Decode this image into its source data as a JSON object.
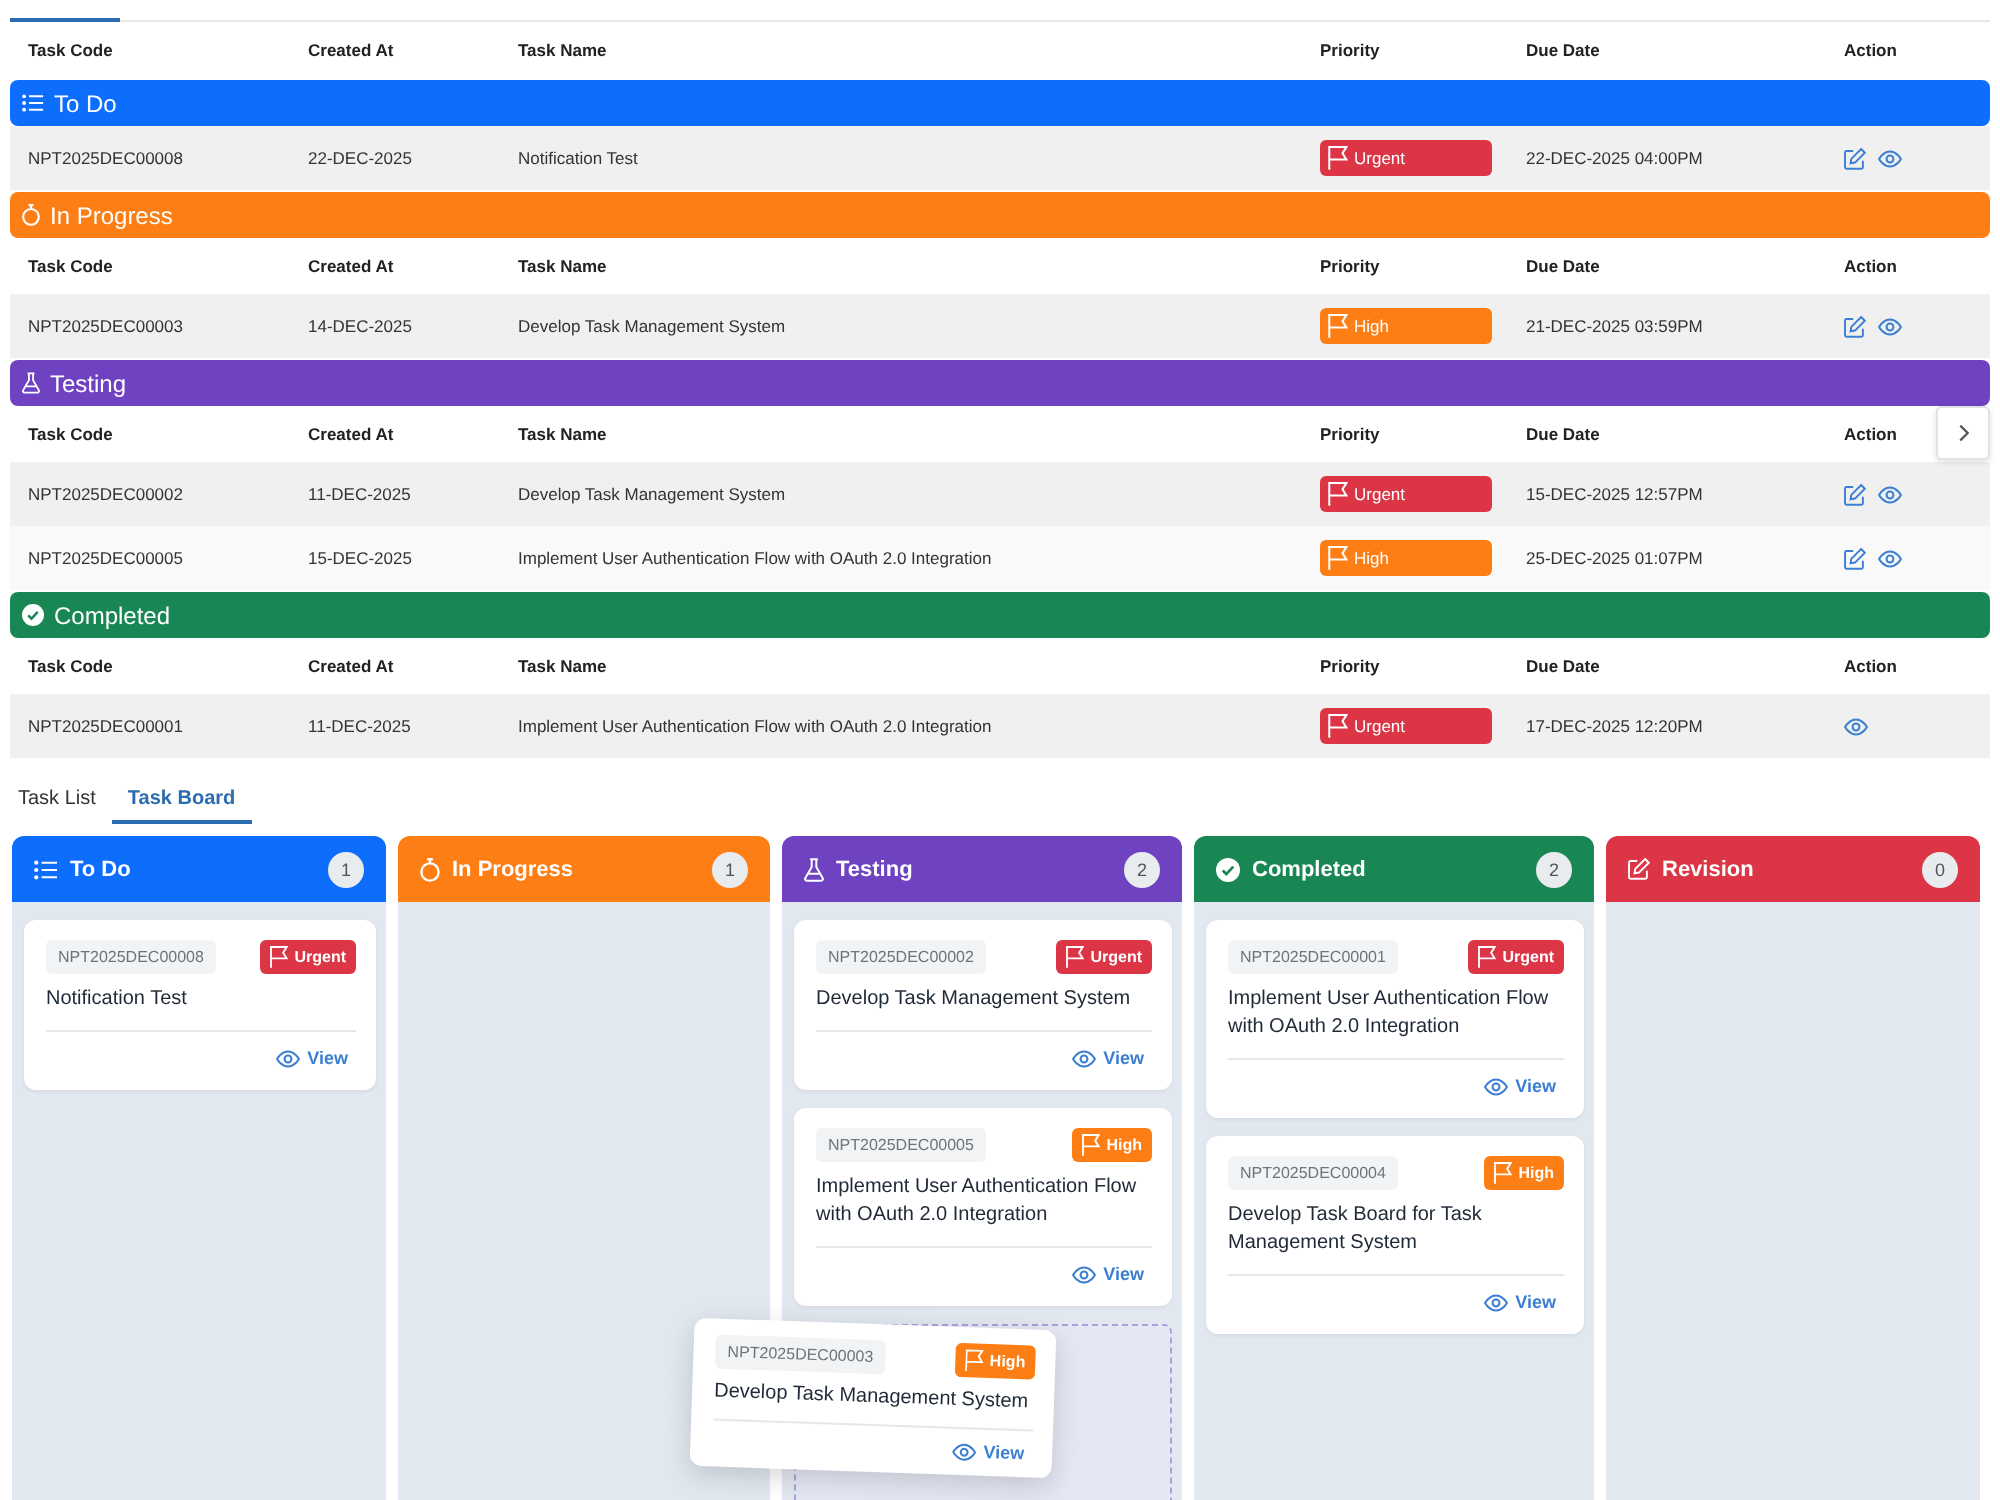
{
  "task_list": {
    "columns": [
      "Task Code",
      "Created At",
      "Task Name",
      "Priority",
      "Due Date",
      "Action"
    ],
    "groups": [
      {
        "kind": "todo",
        "title": "To Do",
        "color": "#0d6efd",
        "rows": [
          {
            "code": "NPT2025DEC00008",
            "created": "22-DEC-2025",
            "name": "Notification Test",
            "priority": {
              "label": "Urgent",
              "color": "#dc3545"
            },
            "due": "22-DEC-2025 04:00PM",
            "editable": true
          }
        ]
      },
      {
        "kind": "in_progress",
        "title": "In Progress",
        "color": "#fd7e14",
        "columns": [
          "Task Code",
          "Created At",
          "Task Name",
          "Priority",
          "Due Date",
          "Action"
        ],
        "rows": [
          {
            "code": "NPT2025DEC00003",
            "created": "14-DEC-2025",
            "name": "Develop Task Management System",
            "priority": {
              "label": "High",
              "color": "#fd7e14"
            },
            "due": "21-DEC-2025 03:59PM",
            "editable": true
          }
        ]
      },
      {
        "kind": "testing",
        "title": "Testing",
        "color": "#6f42c1",
        "columns": [
          "Task Code",
          "Created At",
          "Task Name",
          "Priority",
          "Due Date",
          "Action"
        ],
        "rows": [
          {
            "code": "NPT2025DEC00002",
            "created": "11-DEC-2025",
            "name": "Develop Task Management System",
            "priority": {
              "label": "Urgent",
              "color": "#dc3545"
            },
            "due": "15-DEC-2025 12:57PM",
            "editable": true
          },
          {
            "code": "NPT2025DEC00005",
            "created": "15-DEC-2025",
            "name": "Implement User Authentication Flow with OAuth 2.0 Integration",
            "priority": {
              "label": "High",
              "color": "#fd7e14"
            },
            "due": "25-DEC-2025 01:07PM",
            "editable": true
          }
        ]
      },
      {
        "kind": "completed",
        "title": "Completed",
        "color": "#198754",
        "columns": [
          "Task Code",
          "Created At",
          "Task Name",
          "Priority",
          "Due Date",
          "Action"
        ],
        "rows": [
          {
            "code": "NPT2025DEC00001",
            "created": "11-DEC-2025",
            "name": "Implement User Authentication Flow with OAuth 2.0 Integration",
            "priority": {
              "label": "Urgent",
              "color": "#dc3545"
            },
            "due": "17-DEC-2025 12:20PM",
            "editable": false
          }
        ]
      }
    ]
  },
  "board": {
    "tabs": [
      {
        "label": "Task List",
        "selected": false
      },
      {
        "label": "Task Board",
        "selected": true
      }
    ],
    "columns": [
      {
        "kind": "todo",
        "title": "To Do",
        "count": "1",
        "color": "#0d6efd",
        "drop_target": false,
        "cards": [
          {
            "code": "NPT2025DEC00008",
            "priority": {
              "label": "Urgent",
              "color": "#dc3545"
            },
            "title": "Notification Test",
            "link": "View"
          }
        ]
      },
      {
        "kind": "in_progress",
        "title": "In Progress",
        "count": "1",
        "color": "#fd7e14",
        "drop_target": false
      },
      {
        "kind": "testing",
        "title": "Testing",
        "count": "2",
        "color": "#6f42c1",
        "drop_target": true,
        "cards": [
          {
            "code": "NPT2025DEC00002",
            "priority": {
              "label": "Urgent",
              "color": "#dc3545"
            },
            "title": "Develop Task Management System",
            "link": "View"
          },
          {
            "code": "NPT2025DEC00005",
            "priority": {
              "label": "High",
              "color": "#fd7e14"
            },
            "title": "Implement User Authentication Flow with OAuth 2.0 Integration",
            "link": "View"
          }
        ]
      },
      {
        "kind": "completed",
        "title": "Completed",
        "count": "2",
        "color": "#198754",
        "drop_target": false,
        "cards": [
          {
            "code": "NPT2025DEC00001",
            "priority": {
              "label": "Urgent",
              "color": "#dc3545"
            },
            "title": "Implement User Authentication Flow with OAuth 2.0 Integration",
            "link": "View"
          },
          {
            "code": "NPT2025DEC00004",
            "priority": {
              "label": "High",
              "color": "#fd7e14"
            },
            "title": "Develop Task Board for Task Management System",
            "link": "View"
          }
        ]
      },
      {
        "kind": "revision",
        "title": "Revision",
        "count": "0",
        "color": "#dc3545",
        "drop_target": false
      }
    ],
    "drag_preview": {
      "code": "NPT2025DEC00003",
      "priority": {
        "label": "High",
        "color": "#fd7e14"
      },
      "title": "Develop Task Management System",
      "link": "View"
    }
  }
}
